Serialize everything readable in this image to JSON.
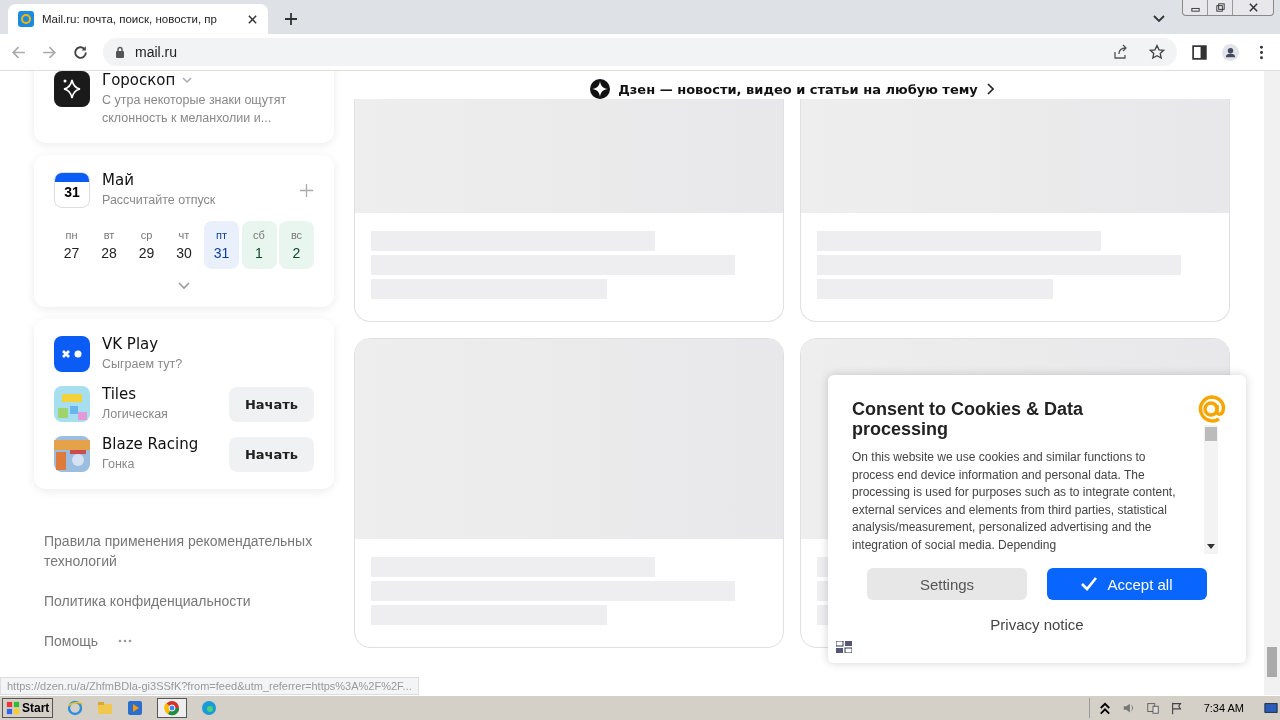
{
  "browser": {
    "tab_title": "Mail.ru: почта, поиск, новости, пр",
    "address": "mail.ru",
    "status_url": "https://dzen.ru/a/ZhfmBDla-gi3SSfK?from=feed&utm_referrer=https%3A%2F%2F..."
  },
  "sidebar": {
    "horoscope": {
      "title": "Гороскоп",
      "text": "С утра некоторые знаки ощутят склонность к меланхолии и..."
    },
    "calendar": {
      "icon_date": "31",
      "month": "Май",
      "hint": "Рассчитайте отпуск",
      "days": [
        {
          "weekday": "пн",
          "date": "27",
          "selected": false,
          "weekend": false
        },
        {
          "weekday": "вт",
          "date": "28",
          "selected": false,
          "weekend": false
        },
        {
          "weekday": "ср",
          "date": "29",
          "selected": false,
          "weekend": false
        },
        {
          "weekday": "чт",
          "date": "30",
          "selected": false,
          "weekend": false
        },
        {
          "weekday": "пт",
          "date": "31",
          "selected": true,
          "weekend": false
        },
        {
          "weekday": "сб",
          "date": "1",
          "selected": false,
          "weekend": true
        },
        {
          "weekday": "вс",
          "date": "2",
          "selected": false,
          "weekend": true
        }
      ]
    },
    "games": {
      "title": "VK Play",
      "subtitle": "Сыграем тут?",
      "items": [
        {
          "name": "Tiles",
          "genre": "Логическая",
          "button": "Начать"
        },
        {
          "name": "Blaze Racing",
          "genre": "Гонка",
          "button": "Начать"
        }
      ]
    },
    "footer_links": [
      "Правила применения рекомендательных технологий",
      "Политика конфиденциальности",
      "Помощь"
    ]
  },
  "feed": {
    "header": "Дзен — новости, видео и статьи на любую тему"
  },
  "cookie_dialog": {
    "title": "Consent to Cookies & Data processing",
    "body": "On this website we use cookies and similar functions to process end device information and personal data. The processing is used for purposes such as to integrate content, external services and elements from third parties, statistical analysis/measurement, personalized advertising and the integration of social media. Depending",
    "settings_button": "Settings",
    "accept_button": "Accept all",
    "privacy_link": "Privacy notice"
  },
  "taskbar": {
    "start": "Start",
    "clock": "7:34 AM"
  }
}
